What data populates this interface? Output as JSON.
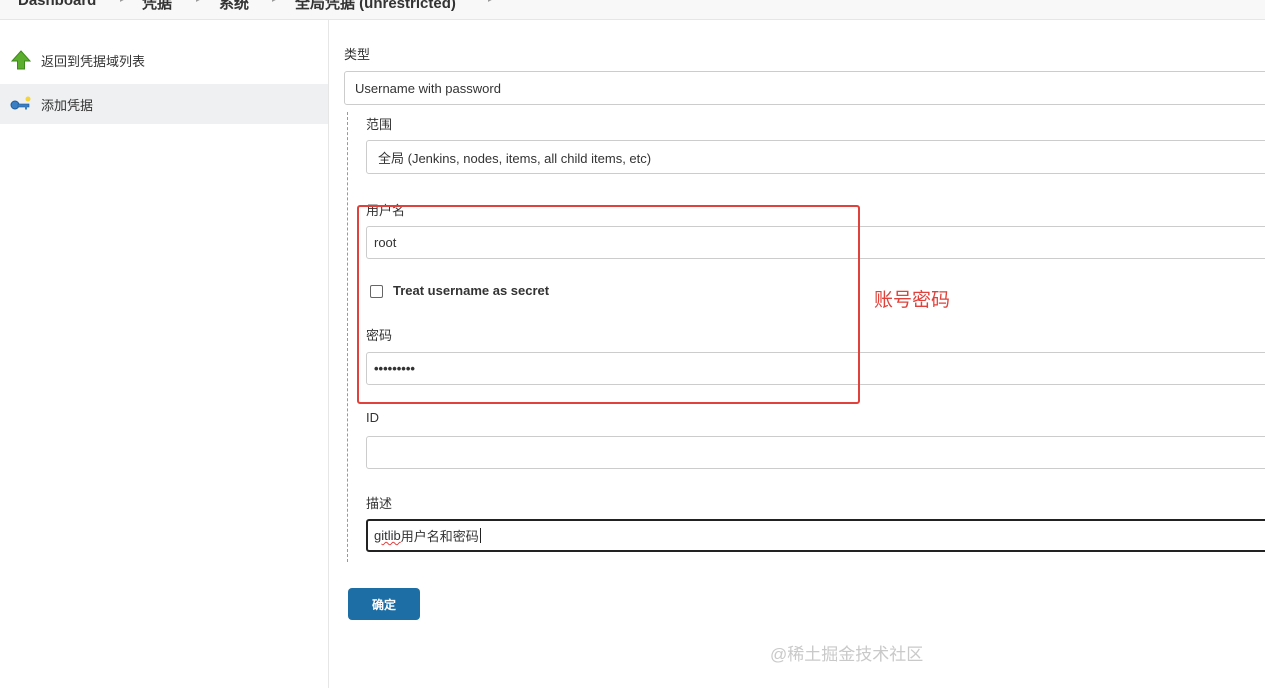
{
  "breadcrumb": {
    "items": [
      "Dashboard",
      "凭据",
      "系统",
      "全局凭据 (unrestricted)"
    ],
    "separator": "▸"
  },
  "sidebar": {
    "items": [
      {
        "label": "返回到凭据域列表",
        "icon": "up-arrow-icon"
      },
      {
        "label": "添加凭据",
        "icon": "key-icon"
      }
    ]
  },
  "form": {
    "kind_label": "类型",
    "kind_value": "Username with password",
    "scope_label": "范围",
    "scope_value": "全局 (Jenkins, nodes, items, all child items, etc)",
    "username_label": "用户名",
    "username_value": "root",
    "treat_secret_label": "Treat username as secret",
    "treat_secret_checked": false,
    "password_label": "密码",
    "password_value": "•••••••••",
    "id_label": "ID",
    "id_value": "",
    "description_label": "描述",
    "description_value_latin": "gitlib",
    "description_value_rest": "用户名和密码",
    "submit_label": "确定"
  },
  "annotation": {
    "note": "账号密码",
    "color": "#e0413a"
  },
  "watermark": "@稀土掘金技术社区",
  "colors": {
    "accent": "#1d6ea5",
    "annotation": "#e0413a",
    "sidebar_active": "#eef0f2"
  }
}
